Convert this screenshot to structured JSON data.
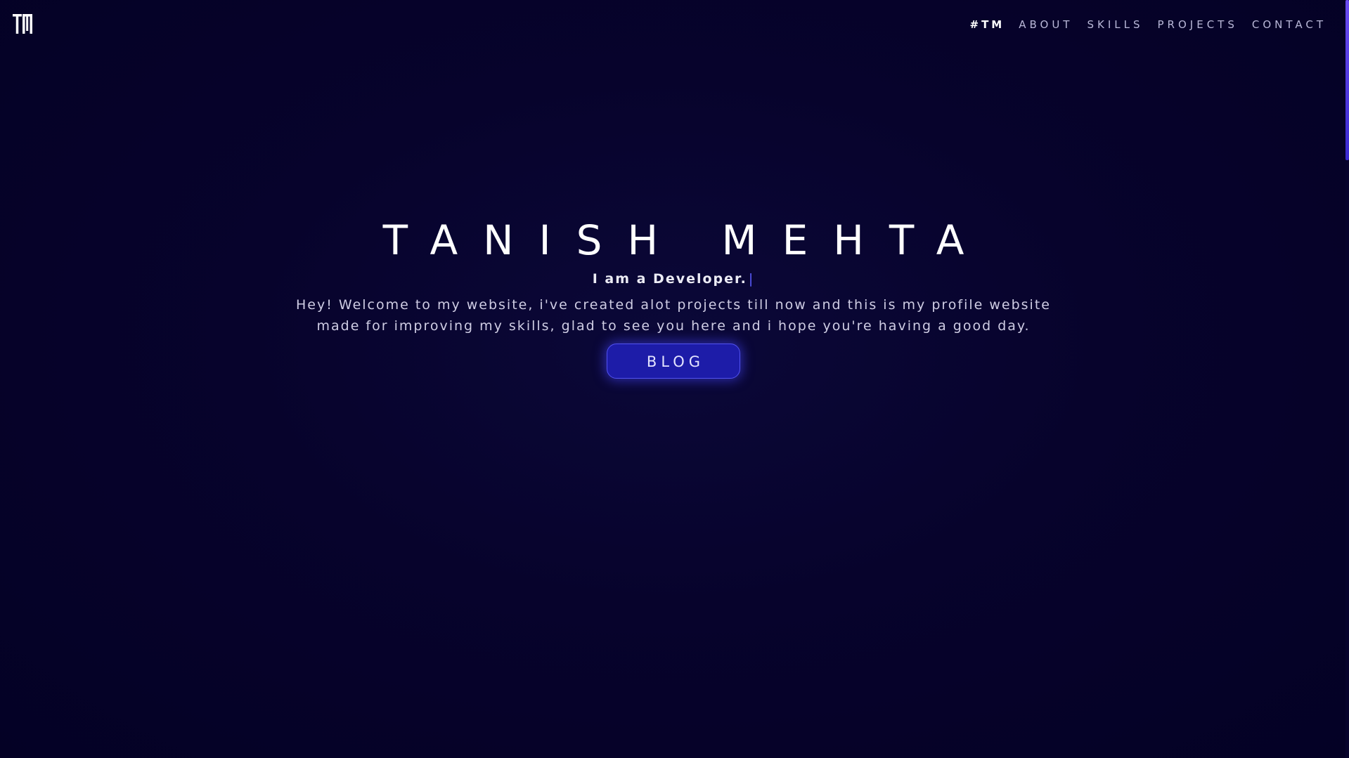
{
  "logo": {
    "text": "TM",
    "icon": "tm-monogram-logo"
  },
  "nav": {
    "items": [
      {
        "label": "#TM",
        "active": true
      },
      {
        "label": "ABOUT",
        "active": false
      },
      {
        "label": "SKILLS",
        "active": false
      },
      {
        "label": "PROJECTS",
        "active": false
      },
      {
        "label": "CONTACT",
        "active": false
      }
    ]
  },
  "hero": {
    "title": "TANISH MEHTA",
    "subtitle": "I am a Developer.",
    "caret": "|",
    "description": "Hey! Welcome to my website, i've created alot projects till now and this is my profile website made for improving my skills, glad to see you here and i hope you're having a good day.",
    "button_label": "BLOG"
  },
  "colors": {
    "background": "#06022a",
    "accent": "#1d1ca8",
    "caret": "#5a5cff",
    "scroll_thumb": "#6a4cf0"
  }
}
